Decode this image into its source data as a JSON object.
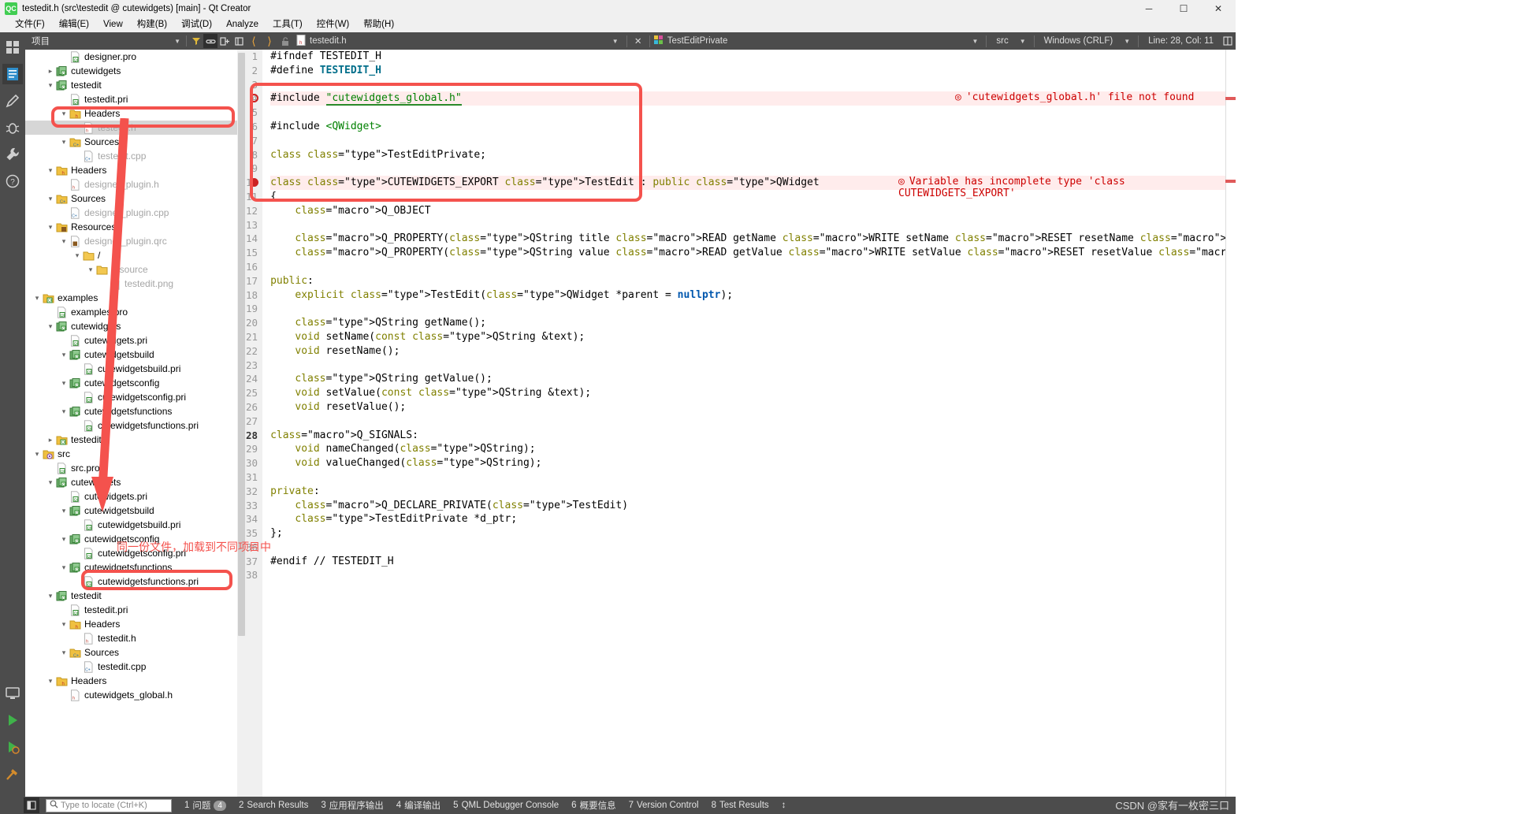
{
  "window": {
    "title": "testedit.h (src\\testedit @ cutewidgets) [main] - Qt Creator",
    "app_icon": "QC",
    "minimize": "─",
    "maximize": "☐",
    "close": "✕"
  },
  "menubar": [
    {
      "label": "文件(F)"
    },
    {
      "label": "编辑(E)"
    },
    {
      "label": "View"
    },
    {
      "label": "构建(B)"
    },
    {
      "label": "调试(D)"
    },
    {
      "label": "Analyze"
    },
    {
      "label": "工具(T)"
    },
    {
      "label": "控件(W)"
    },
    {
      "label": "帮助(H)"
    }
  ],
  "modebar": {
    "items": [
      {
        "name": "welcome-mode",
        "icon": "grid-icon"
      },
      {
        "name": "edit-mode",
        "icon": "document-icon",
        "active": true
      },
      {
        "name": "design-mode",
        "icon": "pencil-icon"
      },
      {
        "name": "debug-mode",
        "icon": "bug-icon"
      },
      {
        "name": "projects-mode",
        "icon": "wrench-icon"
      },
      {
        "name": "help-mode",
        "icon": "help-icon"
      }
    ],
    "bottom": [
      {
        "name": "kit-selector",
        "icon": "monitor-icon"
      },
      {
        "name": "run-button",
        "icon": "play-icon"
      },
      {
        "name": "debug-run-button",
        "icon": "debug-play-icon"
      },
      {
        "name": "build-button",
        "icon": "hammer-icon"
      }
    ]
  },
  "tree_header": {
    "label": "项目",
    "filter_icon": "filter-icon",
    "link_icon": "link-icon",
    "split_icon": "split-icon",
    "collapse_icon": "collapse-icon"
  },
  "tree": [
    {
      "indent": 2,
      "twisty": "",
      "icon": "qt-file",
      "label": "designer.pro",
      "dim": false,
      "sel": false
    },
    {
      "indent": 1,
      "twisty": "›",
      "icon": "qt-proj",
      "label": "cutewidgets",
      "dim": false,
      "sel": false
    },
    {
      "indent": 1,
      "twisty": "⌄",
      "icon": "qt-proj",
      "label": "testedit",
      "dim": false,
      "sel": false
    },
    {
      "indent": 2,
      "twisty": "",
      "icon": "qt-file",
      "label": "testedit.pri",
      "dim": false,
      "sel": false
    },
    {
      "indent": 2,
      "twisty": "⌄",
      "icon": "folder-h",
      "label": "Headers",
      "dim": false,
      "sel": false
    },
    {
      "indent": 3,
      "twisty": "",
      "icon": "h-file",
      "label": "testedit.h",
      "dim": true,
      "sel": true
    },
    {
      "indent": 2,
      "twisty": "⌄",
      "icon": "folder-cpp",
      "label": "Sources",
      "dim": false,
      "sel": false
    },
    {
      "indent": 3,
      "twisty": "",
      "icon": "cpp-file",
      "label": "testedit.cpp",
      "dim": true,
      "sel": false
    },
    {
      "indent": 1,
      "twisty": "⌄",
      "icon": "folder-h",
      "label": "Headers",
      "dim": false,
      "sel": false
    },
    {
      "indent": 2,
      "twisty": "",
      "icon": "h-file",
      "label": "designer_plugin.h",
      "dim": true,
      "sel": false
    },
    {
      "indent": 1,
      "twisty": "⌄",
      "icon": "folder-cpp",
      "label": "Sources",
      "dim": false,
      "sel": false
    },
    {
      "indent": 2,
      "twisty": "",
      "icon": "cpp-file",
      "label": "designer_plugin.cpp",
      "dim": true,
      "sel": false
    },
    {
      "indent": 1,
      "twisty": "⌄",
      "icon": "folder-res",
      "label": "Resources",
      "dim": false,
      "sel": false
    },
    {
      "indent": 2,
      "twisty": "⌄",
      "icon": "qrc-file",
      "label": "designer_plugin.qrc",
      "dim": true,
      "sel": false
    },
    {
      "indent": 3,
      "twisty": "⌄",
      "icon": "folder-plain",
      "label": "/",
      "dim": false,
      "sel": false
    },
    {
      "indent": 4,
      "twisty": "⌄",
      "icon": "folder-plain",
      "label": "resource",
      "dim": true,
      "sel": false
    },
    {
      "indent": 5,
      "twisty": "",
      "icon": "png-file",
      "label": "testedit.png",
      "dim": true,
      "sel": false
    },
    {
      "indent": 0,
      "twisty": "⌄",
      "icon": "qt-folder",
      "label": "examples",
      "dim": false,
      "sel": false
    },
    {
      "indent": 1,
      "twisty": "",
      "icon": "qt-file",
      "label": "examples.pro",
      "dim": false,
      "sel": false
    },
    {
      "indent": 1,
      "twisty": "⌄",
      "icon": "qt-proj",
      "label": "cutewidgets",
      "dim": false,
      "sel": false
    },
    {
      "indent": 2,
      "twisty": "",
      "icon": "qt-file",
      "label": "cutewidgets.pri",
      "dim": false,
      "sel": false
    },
    {
      "indent": 2,
      "twisty": "⌄",
      "icon": "qt-proj",
      "label": "cutewidgetsbuild",
      "dim": false,
      "sel": false
    },
    {
      "indent": 3,
      "twisty": "",
      "icon": "qt-file",
      "label": "cutewidgetsbuild.pri",
      "dim": false,
      "sel": false
    },
    {
      "indent": 2,
      "twisty": "⌄",
      "icon": "qt-proj",
      "label": "cutewidgetsconfig",
      "dim": false,
      "sel": false
    },
    {
      "indent": 3,
      "twisty": "",
      "icon": "qt-file",
      "label": "cutewidgetsconfig.pri",
      "dim": false,
      "sel": false
    },
    {
      "indent": 2,
      "twisty": "⌄",
      "icon": "qt-proj",
      "label": "cutewidgetsfunctions",
      "dim": false,
      "sel": false
    },
    {
      "indent": 3,
      "twisty": "",
      "icon": "qt-file",
      "label": "cutewidgetsfunctions.pri",
      "dim": false,
      "sel": false
    },
    {
      "indent": 1,
      "twisty": "›",
      "icon": "qt-folder",
      "label": "testedit",
      "dim": false,
      "sel": false
    },
    {
      "indent": 0,
      "twisty": "⌄",
      "icon": "folder-gear",
      "label": "src",
      "dim": false,
      "sel": false
    },
    {
      "indent": 1,
      "twisty": "",
      "icon": "qt-file",
      "label": "src.pro",
      "dim": false,
      "sel": false
    },
    {
      "indent": 1,
      "twisty": "⌄",
      "icon": "qt-proj",
      "label": "cutewidgets",
      "dim": false,
      "sel": false
    },
    {
      "indent": 2,
      "twisty": "",
      "icon": "qt-file",
      "label": "cutewidgets.pri",
      "dim": false,
      "sel": false
    },
    {
      "indent": 2,
      "twisty": "⌄",
      "icon": "qt-proj",
      "label": "cutewidgetsbuild",
      "dim": false,
      "sel": false
    },
    {
      "indent": 3,
      "twisty": "",
      "icon": "qt-file",
      "label": "cutewidgetsbuild.pri",
      "dim": false,
      "sel": false
    },
    {
      "indent": 2,
      "twisty": "⌄",
      "icon": "qt-proj",
      "label": "cutewidgetsconfig",
      "dim": false,
      "sel": false
    },
    {
      "indent": 3,
      "twisty": "",
      "icon": "qt-file",
      "label": "cutewidgetsconfig.pri",
      "dim": false,
      "sel": false
    },
    {
      "indent": 2,
      "twisty": "⌄",
      "icon": "qt-proj",
      "label": "cutewidgetsfunctions",
      "dim": false,
      "sel": false
    },
    {
      "indent": 3,
      "twisty": "",
      "icon": "qt-file",
      "label": "cutewidgetsfunctions.pri",
      "dim": false,
      "sel": false
    },
    {
      "indent": 1,
      "twisty": "⌄",
      "icon": "qt-proj",
      "label": "testedit",
      "dim": false,
      "sel": false
    },
    {
      "indent": 2,
      "twisty": "",
      "icon": "qt-file",
      "label": "testedit.pri",
      "dim": false,
      "sel": false
    },
    {
      "indent": 2,
      "twisty": "⌄",
      "icon": "folder-h",
      "label": "Headers",
      "dim": false,
      "sel": false
    },
    {
      "indent": 3,
      "twisty": "",
      "icon": "h-file",
      "label": "testedit.h",
      "dim": false,
      "sel": false
    },
    {
      "indent": 2,
      "twisty": "⌄",
      "icon": "folder-cpp",
      "label": "Sources",
      "dim": false,
      "sel": false
    },
    {
      "indent": 3,
      "twisty": "",
      "icon": "cpp-file",
      "label": "testedit.cpp",
      "dim": false,
      "sel": false
    },
    {
      "indent": 1,
      "twisty": "⌄",
      "icon": "folder-h",
      "label": "Headers",
      "dim": false,
      "sel": false
    },
    {
      "indent": 2,
      "twisty": "",
      "icon": "h-file",
      "label": "cutewidgets_global.h",
      "dim": false,
      "sel": false
    }
  ],
  "editor_toolbar": {
    "back_icon": "back-arrow-icon",
    "forward_icon": "forward-arrow-icon",
    "lock_icon": "unlock-icon",
    "file_name": "testedit.h",
    "close_icon": "✕",
    "symbol_name": "TestEditPrivate",
    "scope_label": "src",
    "encoding": "Windows (CRLF)",
    "cursor_position": "Line: 28, Col: 11",
    "split_icon": "split-editor-icon",
    "add_split_icon": "add-split-icon",
    "filter_icon": "filter-icon"
  },
  "code": {
    "lines": [
      {
        "n": 1,
        "text": "#ifndef TESTEDIT_H"
      },
      {
        "n": 2,
        "text": "#define TESTEDIT_H"
      },
      {
        "n": 3,
        "text": ""
      },
      {
        "n": 4,
        "text": "#include \"cutewidgets_global.h\""
      },
      {
        "n": 5,
        "text": ""
      },
      {
        "n": 6,
        "text": "#include <QWidget>"
      },
      {
        "n": 7,
        "text": ""
      },
      {
        "n": 8,
        "text": "class TestEditPrivate;"
      },
      {
        "n": 9,
        "text": ""
      },
      {
        "n": 10,
        "text": "class CUTEWIDGETS_EXPORT TestEdit : public QWidget"
      },
      {
        "n": 11,
        "text": "{"
      },
      {
        "n": 12,
        "text": "    Q_OBJECT"
      },
      {
        "n": 13,
        "text": ""
      },
      {
        "n": 14,
        "text": "    Q_PROPERTY(QString title READ getName WRITE setName RESET resetName NOTIFY nameChanged)"
      },
      {
        "n": 15,
        "text": "    Q_PROPERTY(QString value READ getValue WRITE setValue RESET resetValue NOTIFY valueChanged)"
      },
      {
        "n": 16,
        "text": ""
      },
      {
        "n": 17,
        "text": "public:"
      },
      {
        "n": 18,
        "text": "    explicit TestEdit(QWidget *parent = nullptr);"
      },
      {
        "n": 19,
        "text": ""
      },
      {
        "n": 20,
        "text": "    QString getName();"
      },
      {
        "n": 21,
        "text": "    void setName(const QString &text);"
      },
      {
        "n": 22,
        "text": "    void resetName();"
      },
      {
        "n": 23,
        "text": ""
      },
      {
        "n": 24,
        "text": "    QString getValue();"
      },
      {
        "n": 25,
        "text": "    void setValue(const QString &text);"
      },
      {
        "n": 26,
        "text": "    void resetValue();"
      },
      {
        "n": 27,
        "text": ""
      },
      {
        "n": 28,
        "text": "Q_SIGNALS:"
      },
      {
        "n": 29,
        "text": "    void nameChanged(QString);"
      },
      {
        "n": 30,
        "text": "    void valueChanged(QString);"
      },
      {
        "n": 31,
        "text": ""
      },
      {
        "n": 32,
        "text": "private:"
      },
      {
        "n": 33,
        "text": "    Q_DECLARE_PRIVATE(TestEdit)"
      },
      {
        "n": 34,
        "text": "    TestEditPrivate *d_ptr;"
      },
      {
        "n": 35,
        "text": "};"
      },
      {
        "n": 36,
        "text": ""
      },
      {
        "n": 37,
        "text": "#endif // TESTEDIT_H"
      },
      {
        "n": 38,
        "text": ""
      }
    ],
    "errors": [
      {
        "line": 4,
        "message": "'cutewidgets_global.h' file not found"
      },
      {
        "line": 10,
        "message": "Variable has incomplete type 'class CUTEWIDGETS_EXPORT'"
      }
    ]
  },
  "annotations": {
    "note_text": "同一份文件，加载到不同项目中",
    "color": "#f4524d"
  },
  "statusbar": {
    "toggle_sidebar_icon": "sidebar-toggle-icon",
    "search_icon": "search-icon",
    "search_placeholder": "Type to locate (Ctrl+K)",
    "search_value": "",
    "items": [
      {
        "num": "1",
        "label": "问题",
        "badge": "4"
      },
      {
        "num": "2",
        "label": "Search Results",
        "badge": ""
      },
      {
        "num": "3",
        "label": "应用程序输出",
        "badge": ""
      },
      {
        "num": "4",
        "label": "编译输出",
        "badge": ""
      },
      {
        "num": "5",
        "label": "QML Debugger Console",
        "badge": ""
      },
      {
        "num": "6",
        "label": "概要信息",
        "badge": ""
      },
      {
        "num": "7",
        "label": "Version Control",
        "badge": ""
      },
      {
        "num": "8",
        "label": "Test Results",
        "badge": ""
      }
    ],
    "expand_icon": "↕",
    "watermark": "CSDN @家有一枚密三口"
  }
}
